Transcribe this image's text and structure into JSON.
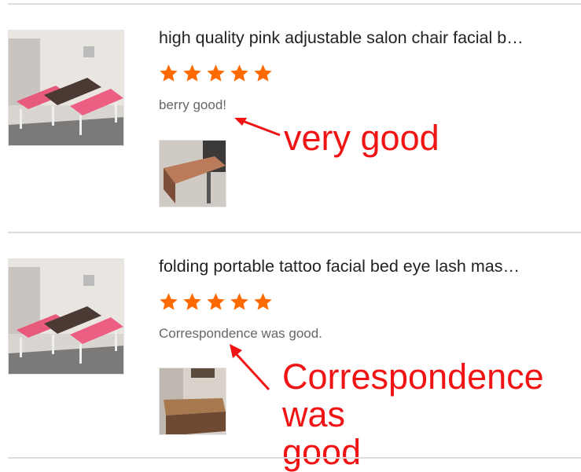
{
  "reviews": [
    {
      "product_title": "high quality pink adjustable salon chair facial b…",
      "rating": 5,
      "comment": "berry good!",
      "annotation": "very good",
      "icons": {
        "star": "filled-star-icon",
        "arrow": "red-arrow-icon"
      }
    },
    {
      "product_title": "folding portable tattoo facial bed eye lash mas…",
      "rating": 5,
      "comment": "Correspondence was good.",
      "annotation_lines": [
        "Correspondence was",
        "good"
      ],
      "icons": {
        "star": "filled-star-icon",
        "arrow": "red-arrow-icon"
      }
    }
  ],
  "colors": {
    "star": "#ff6a00",
    "annotation": "#f01414",
    "divider": "#dcdcdc"
  }
}
